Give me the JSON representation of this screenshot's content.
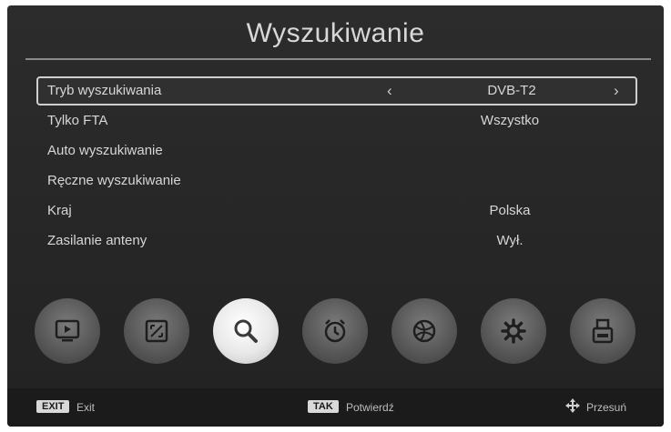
{
  "title": "Wyszukiwanie",
  "menu": {
    "items": [
      {
        "label": "Tryb wyszukiwania",
        "value": "DVB-T2"
      },
      {
        "label": "Tylko FTA",
        "value": "Wszystko"
      },
      {
        "label": "Auto wyszukiwanie",
        "value": ""
      },
      {
        "label": "Ręczne wyszukiwanie",
        "value": ""
      },
      {
        "label": "Kraj",
        "value": "Polska"
      },
      {
        "label": "Zasilanie anteny",
        "value": "Wył."
      }
    ],
    "arrow_left": "‹",
    "arrow_right": "›"
  },
  "icons": [
    {
      "name": "tv-icon"
    },
    {
      "name": "picture-icon"
    },
    {
      "name": "search-icon",
      "active": true
    },
    {
      "name": "alarm-clock-icon"
    },
    {
      "name": "globe-icon"
    },
    {
      "name": "gear-icon"
    },
    {
      "name": "usb-icon"
    }
  ],
  "footer": {
    "exit_key": "EXIT",
    "exit_label": "Exit",
    "ok_key": "TAK",
    "ok_label": "Potwierdź",
    "move_label": "Przesuń"
  }
}
